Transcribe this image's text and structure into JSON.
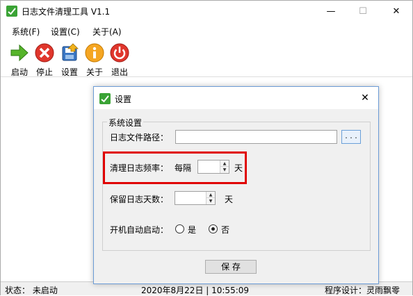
{
  "app": {
    "title": "日志文件清理工具 V1.1"
  },
  "window_controls": {
    "minimize": "—",
    "maximize": "☐",
    "close": "✕"
  },
  "menu": {
    "items": [
      "系统(F)",
      "设置(C)",
      "关于(A)"
    ]
  },
  "toolbar": {
    "items": [
      {
        "label": "启动",
        "icon": "start-arrow-icon"
      },
      {
        "label": "停止",
        "icon": "stop-icon"
      },
      {
        "label": "设置",
        "icon": "settings-icon"
      },
      {
        "label": "关于",
        "icon": "info-icon"
      },
      {
        "label": "退出",
        "icon": "power-icon"
      }
    ]
  },
  "statusbar": {
    "status": "状态：  未启动",
    "datetime": "2020年8月22日  |  10:55:09",
    "designer": "程序设计：灵雨飘零"
  },
  "dialog": {
    "title": "设置",
    "close": "✕",
    "group_title": "系统设置",
    "log_path_label": "日志文件路径：",
    "log_path_value": "",
    "browse_label": ". . .",
    "frequency_label": "清理日志频率：",
    "frequency_prefix": "每隔",
    "frequency_value": "",
    "frequency_unit": "天",
    "keep_days_label": "保留日志天数：",
    "keep_days_value": "",
    "keep_days_unit": "天",
    "autostart_label": "开机自动启动：",
    "autostart_options": [
      "是",
      "否"
    ],
    "autostart_selected": "否",
    "save_label": "保 存",
    "spin_up": "▲",
    "spin_down": "▼"
  },
  "colors": {
    "highlight": "#e00000",
    "dialog_border": "#6b9bd6"
  }
}
